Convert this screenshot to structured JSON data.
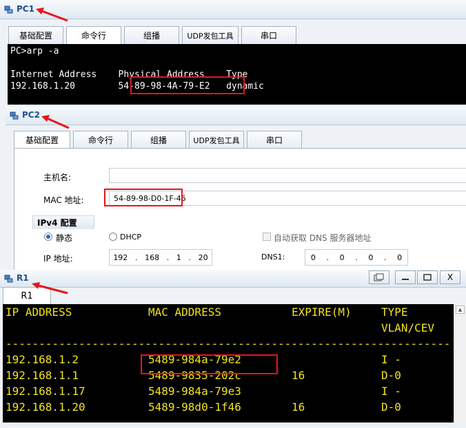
{
  "pc1": {
    "title": "PC1",
    "tabs": [
      "基础配置",
      "命令行",
      "组播",
      "UDP发包工具",
      "串口"
    ],
    "terminal_lines": [
      "PC>arp -a",
      "",
      "Internet Address    Physical Address    Type",
      "192.168.1.20        54-89-98-4A-79-E2   dynamic"
    ]
  },
  "pc2": {
    "title": "PC2",
    "tabs": [
      "基础配置",
      "命令行",
      "组播",
      "UDP发包工具",
      "串口"
    ],
    "hostname_label": "主机名:",
    "hostname_value": "",
    "mac_label": "MAC 地址:",
    "mac_value": "54-89-98-D0-1F-46",
    "ipv4_section": "IPv4 配置",
    "static_label": "静态",
    "dhcp_label": "DHCP",
    "auto_dns_label": "自动获取 DNS 服务器地址",
    "ip_label": "IP 地址:",
    "ip_octets": [
      "192",
      "168",
      "1",
      "20"
    ],
    "dns1_label": "DNS1:",
    "dns1_octets": [
      "0",
      "0",
      "0",
      "0"
    ],
    "ip_mode": "static"
  },
  "r1": {
    "title": "R1",
    "tab": "R1",
    "window_buttons": [
      "restore",
      "minimize",
      "maximize",
      "close"
    ],
    "close_label": "X",
    "headers": {
      "ip": "IP ADDRESS",
      "mac": "MAC ADDRESS",
      "expire": "EXPIRE(M)",
      "type": "TYPE",
      "type2": "VLAN/CEV"
    },
    "separator": "------------------------------------------------------------------------------",
    "rows": [
      {
        "ip": "192.168.1.2",
        "mac": "5489-984a-79e2",
        "expire": "",
        "type": "I -"
      },
      {
        "ip": "192.168.1.1",
        "mac": "5489-9835-202c",
        "expire": "16",
        "type": "D-0"
      },
      {
        "ip": "192.168.1.17",
        "mac": "5489-984a-79e3",
        "expire": "",
        "type": "I -"
      },
      {
        "ip": "192.168.1.20",
        "mac": "5489-98d0-1f46",
        "expire": "16",
        "type": "D-0"
      }
    ]
  },
  "colors": {
    "highlight": "#e8141a",
    "router_text": "#f0e41c",
    "title_text": "#1f4e8c"
  },
  "icons": {
    "device": "pc-device-icon",
    "restore": "restore-icon",
    "minimize": "minimize-icon",
    "maximize": "maximize-icon",
    "close": "close-icon",
    "arrow": "annotation-arrow"
  }
}
